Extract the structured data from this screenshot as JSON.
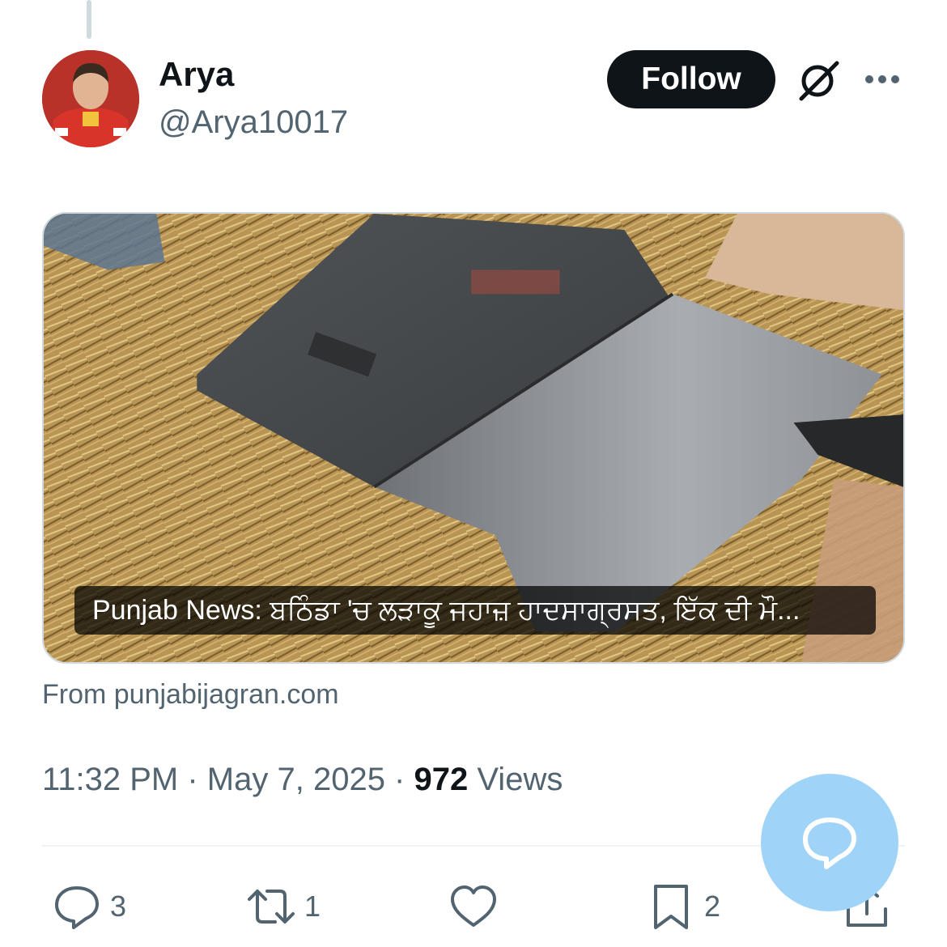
{
  "author": {
    "display_name": "Arya",
    "handle": "@Arya10017"
  },
  "header": {
    "follow_label": "Follow"
  },
  "link_card": {
    "caption": "Punjab News: ਬਠਿੰਡਾ 'ਚ ਲੜਾਕੂ ਜਹਾਜ਼ ਹਾਦਸਾਗ੍ਰਸਤ, ਇੱਕ ਦੀ ਮੌ...",
    "source": "From punjabijagran.com"
  },
  "meta": {
    "time": "11:32 PM",
    "separator": " · ",
    "date": "May 7, 2025",
    "views_count": "972",
    "views_label": " Views"
  },
  "actions": {
    "replies": "3",
    "reposts": "1",
    "bookmarks": "2"
  },
  "icons": [
    "reply-icon",
    "repost-icon",
    "like-icon",
    "bookmark-icon",
    "share-icon",
    "grok-icon",
    "more-icon",
    "compose-reply-icon"
  ],
  "colors": {
    "follow_bg": "#0f1419",
    "secondary_text": "#536471",
    "fab_bg": "#9fd3f7"
  }
}
